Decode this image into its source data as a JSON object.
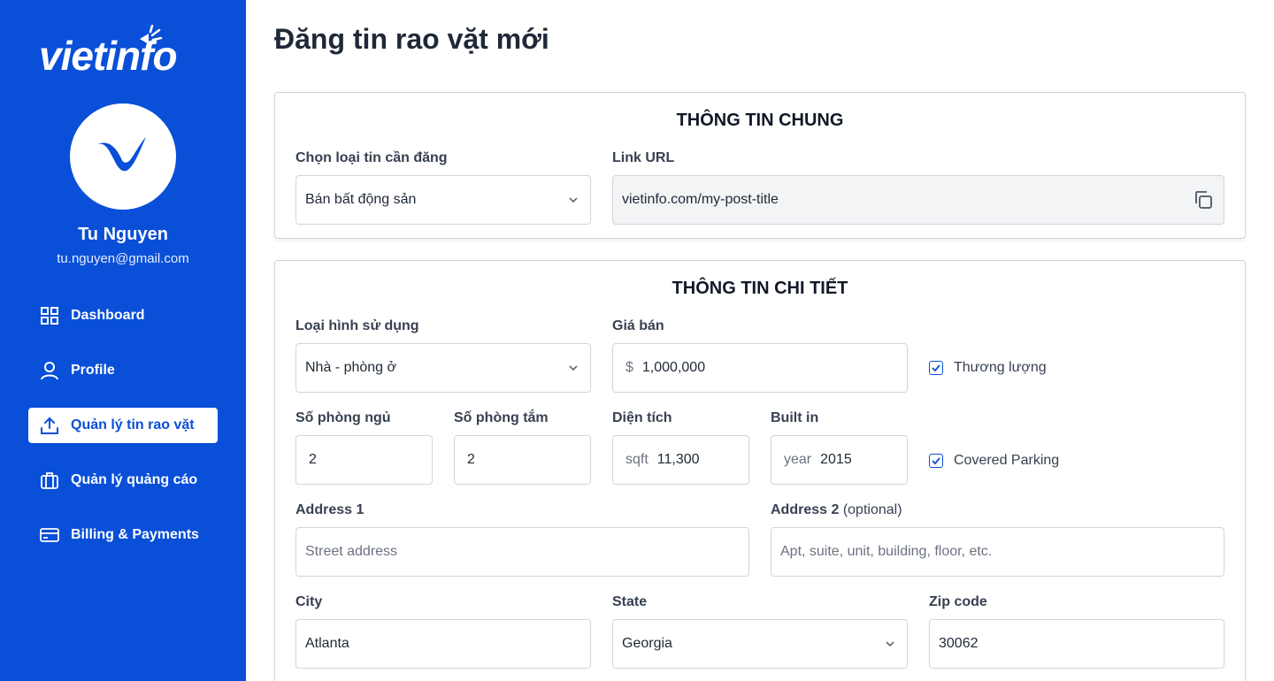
{
  "brand": {
    "logo_text": "vietinfo",
    "primary_color": "#0a4fd8"
  },
  "user": {
    "name": "Tu Nguyen",
    "email": "tu.nguyen@gmail.com"
  },
  "nav": [
    {
      "label": "Dashboard",
      "icon": "grid-icon"
    },
    {
      "label": "Profile",
      "icon": "user-icon"
    },
    {
      "label": "Quản lý tin rao vặt",
      "icon": "upload-icon",
      "active": true
    },
    {
      "label": "Quản lý quảng cáo",
      "icon": "briefcase-icon"
    },
    {
      "label": "Billing & Payments",
      "icon": "credit-card-icon"
    }
  ],
  "page": {
    "title": "Đăng tin rao vặt mới"
  },
  "general": {
    "title": "THÔNG TIN CHUNG",
    "post_type_label": "Chọn loại tin cần đăng",
    "post_type_value": "Bán bất động sản",
    "url_label": "Link URL",
    "url_value": "vietinfo.com/my-post-title"
  },
  "detail": {
    "title": "THÔNG TIN CHI TIẾT",
    "usage_label": "Loại hình sử dụng",
    "usage_value": "Nhà - phòng ở",
    "price_label": "Giá bán",
    "price_prefix": "$",
    "price_value": "1,000,000",
    "negotiable_label": "Thương lượng",
    "negotiable_checked": true,
    "bedrooms_label": "Số phòng ngủ",
    "bedrooms_value": "2",
    "bathrooms_label": "Số phòng tắm",
    "bathrooms_value": "2",
    "area_label": "Diện tích",
    "area_prefix": "sqft",
    "area_value": "11,300",
    "built_label": "Built in",
    "built_prefix": "year",
    "built_value": "2015",
    "parking_label": "Covered Parking",
    "parking_checked": true,
    "address1_label": "Address 1",
    "address1_placeholder": "Street address",
    "address2_label": "Address 2",
    "address2_optional": "(optional)",
    "address2_placeholder": "Apt, suite, unit, building, floor, etc.",
    "city_label": "City",
    "city_value": "Atlanta",
    "state_label": "State",
    "state_value": "Georgia",
    "zip_label": "Zip code",
    "zip_value": "30062"
  }
}
